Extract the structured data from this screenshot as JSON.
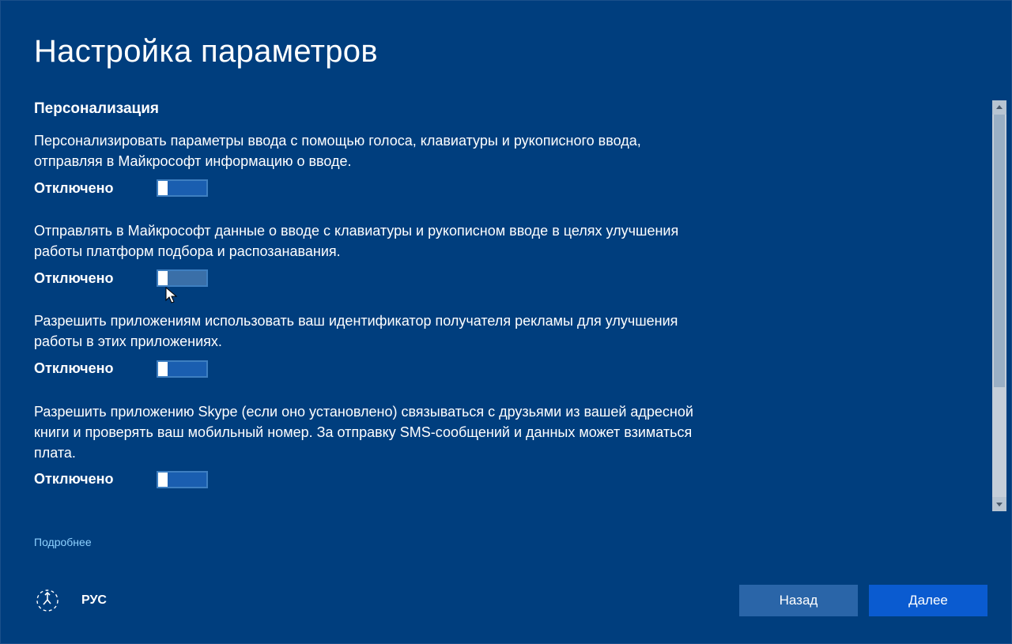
{
  "title": "Настройка параметров",
  "section": "Персонализация",
  "state_off": "Отключено",
  "settings": [
    {
      "desc": "Персонализировать параметры ввода с помощью голоса, клавиатуры и рукописного ввода, отправляя в Майкрософт информацию о вводе.",
      "hover": false
    },
    {
      "desc": "Отправлять в Майкрософт данные о вводе с клавиатуры и рукописном вводе в целях улучшения работы платформ подбора и распозанавания.",
      "hover": true
    },
    {
      "desc": "Разрешить приложениям использовать ваш идентификатор получателя рекламы для улучшения работы в этих приложениях.",
      "hover": false
    },
    {
      "desc": "Разрешить приложению Skype (если оно установлено) связываться с друзьями из вашей адресной книги и проверять ваш мобильный номер. За отправку SMS-сообщений и данных может взиматься плата.",
      "hover": false
    }
  ],
  "learn_more": "Подробнее",
  "lang": "РУС",
  "buttons": {
    "back": "Назад",
    "next": "Далее"
  }
}
